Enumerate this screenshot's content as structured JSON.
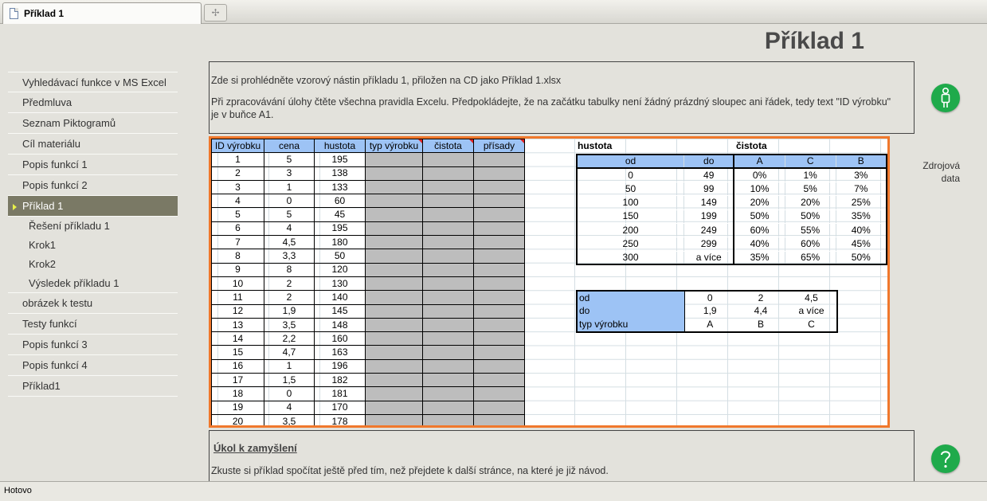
{
  "tab": {
    "title": "Příklad 1",
    "new_tab_symbol": "✢"
  },
  "page_title": "Příklad 1",
  "sidebar": {
    "items": [
      "Vyhledávací funkce v MS Excel",
      "Předmluva",
      "Seznam Piktogramů",
      "Cíl materiálu",
      "Popis funkcí 1",
      "Popis funkcí 2"
    ],
    "active": "Příklad 1",
    "subitems": [
      "Řešení příkladu 1",
      "Krok1",
      "Krok2",
      "Výsledek příkladu 1"
    ],
    "items_after": [
      "obrázek k testu",
      "Testy funkcí",
      "Popis funkcí 3",
      "Popis funkcí 4",
      "Příklad1"
    ]
  },
  "info": {
    "line1": "Zde si prohlédněte vzorový nástin příkladu 1, přiložen na CD jako Příklad 1.xlsx",
    "line2": "Při zpracovávání úlohy čtěte všechna pravidla Excelu. Předpokládejte, že na začátku tabulky není žádný prázdný sloupec ani řádek, tedy text \"ID výrobku\" je v buňce A1."
  },
  "sheet": {
    "headers": [
      "ID výrobku",
      "cena",
      "hustota",
      "typ výrobku",
      "čistota",
      "přísady"
    ],
    "rows": [
      [
        "1",
        "5",
        "195"
      ],
      [
        "2",
        "3",
        "138"
      ],
      [
        "3",
        "1",
        "133"
      ],
      [
        "4",
        "0",
        "60"
      ],
      [
        "5",
        "5",
        "45"
      ],
      [
        "6",
        "4",
        "195"
      ],
      [
        "7",
        "4,5",
        "180"
      ],
      [
        "8",
        "3,3",
        "50"
      ],
      [
        "9",
        "8",
        "120"
      ],
      [
        "10",
        "2",
        "130"
      ],
      [
        "11",
        "2",
        "140"
      ],
      [
        "12",
        "1,9",
        "145"
      ],
      [
        "13",
        "3,5",
        "148"
      ],
      [
        "14",
        "2,2",
        "160"
      ],
      [
        "15",
        "4,7",
        "163"
      ],
      [
        "16",
        "1",
        "196"
      ],
      [
        "17",
        "1,5",
        "182"
      ],
      [
        "18",
        "0",
        "181"
      ],
      [
        "19",
        "4",
        "170"
      ],
      [
        "20",
        "3,5",
        "178"
      ]
    ],
    "density_label": "hustota",
    "purity_label": "čistota",
    "density_headers": [
      "od",
      "do",
      "A",
      "C",
      "B"
    ],
    "density_rows": [
      [
        "0",
        "49",
        "0%",
        "1%",
        "3%"
      ],
      [
        "50",
        "99",
        "10%",
        "5%",
        "7%"
      ],
      [
        "100",
        "149",
        "20%",
        "20%",
        "25%"
      ],
      [
        "150",
        "199",
        "50%",
        "50%",
        "35%"
      ],
      [
        "200",
        "249",
        "60%",
        "55%",
        "40%"
      ],
      [
        "250",
        "299",
        "40%",
        "60%",
        "45%"
      ],
      [
        "300",
        "a více",
        "35%",
        "65%",
        "50%"
      ]
    ],
    "type_rows": [
      [
        "od",
        "0",
        "2",
        "4,5"
      ],
      [
        "do",
        "1,9",
        "4,4",
        "a více"
      ],
      [
        "typ výrobku",
        "A",
        "B",
        "C"
      ]
    ]
  },
  "source_data_label": "Zdrojová data",
  "task": {
    "title": "Úkol k zamyšlení",
    "text": "Zkuste si příklad spočítat ještě před tím, než přejdete k další stránce, na které je již návod."
  },
  "status": "Hotovo",
  "colors": {
    "accent_orange": "#f0782c",
    "header_blue": "#9dc3f5",
    "icon_green": "#1faa4b",
    "nav_active": "#7a7965"
  }
}
